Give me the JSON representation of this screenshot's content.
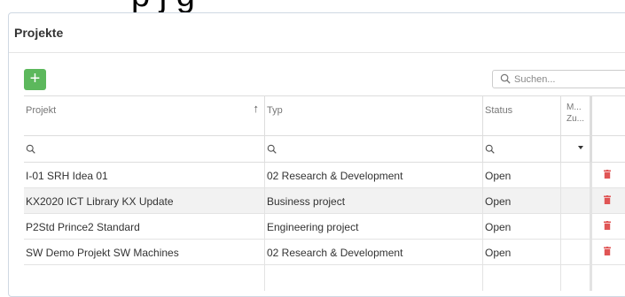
{
  "top_partial_text": "p           j     g",
  "panel": {
    "title": "Projekte"
  },
  "toolbar": {
    "add_label": "+",
    "search_placeholder": "Suchen..."
  },
  "table": {
    "headers": [
      "Projekt",
      "Typ",
      "Status",
      "M... Zu...",
      ""
    ],
    "header_m_line1": "M...",
    "header_m_line2": "Zu...",
    "sort_indicator": "↑",
    "rows": [
      {
        "projekt": "I-01 SRH Idea 01",
        "typ": "02 Research & Development",
        "status": "Open"
      },
      {
        "projekt": "KX2020 ICT Library KX Update",
        "typ": "Business project",
        "status": "Open"
      },
      {
        "projekt": "P2Std Prince2 Standard",
        "typ": "Engineering project",
        "status": "Open"
      },
      {
        "projekt": "SW Demo Projekt SW Machines",
        "typ": "02 Research & Development",
        "status": "Open"
      }
    ]
  },
  "colors": {
    "add_button": "#5cb85c",
    "delete_icon": "#e05555",
    "alt_row": "#f2f2f2"
  }
}
